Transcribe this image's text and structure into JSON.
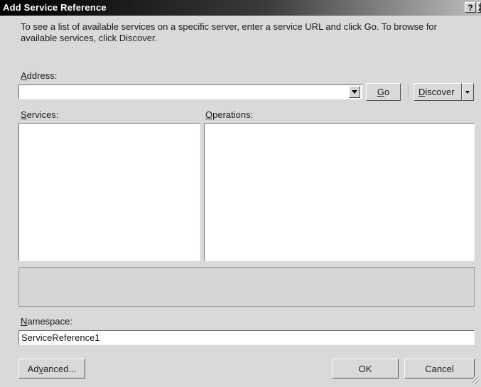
{
  "window": {
    "title": "Add Service Reference",
    "help_label": "?",
    "close_label": "X"
  },
  "intro_text": "To see a list of available services on a specific server, enter a service URL and click Go. To browse for available services, click Discover.",
  "address": {
    "label_mnemonic": "A",
    "label_rest": "ddress:",
    "value": "",
    "go_mnemonic": "G",
    "go_rest": "o",
    "discover_mnemonic": "D",
    "discover_rest": "iscover"
  },
  "services": {
    "label_mnemonic": "S",
    "label_rest": "ervices:",
    "items": []
  },
  "operations": {
    "label_mnemonic": "O",
    "label_rest": "perations:",
    "items": []
  },
  "namespace": {
    "label_mnemonic": "N",
    "label_rest": "amespace:",
    "value": "ServiceReference1"
  },
  "buttons": {
    "advanced_pre": "Ad",
    "advanced_mnemonic": "v",
    "advanced_post": "anced...",
    "ok": "OK",
    "cancel": "Cancel"
  }
}
